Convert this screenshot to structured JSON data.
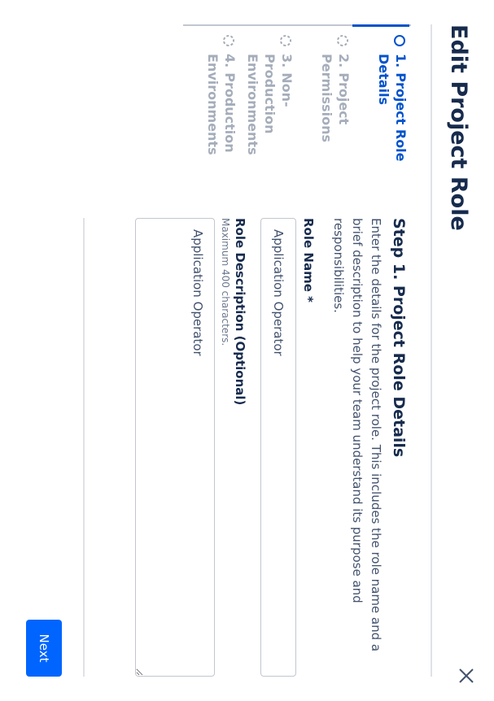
{
  "modal": {
    "title": "Edit Project Role",
    "close_icon": "close-icon"
  },
  "stepper": {
    "steps": [
      {
        "number": "1.",
        "label": "Project Role Details",
        "state": "active"
      },
      {
        "number": "2.",
        "label": "Project Permissions",
        "state": "inactive"
      },
      {
        "number": "3.",
        "label": "Non-Production Environments",
        "state": "inactive"
      },
      {
        "number": "4.",
        "label": "Production Environments",
        "state": "inactive"
      }
    ]
  },
  "form": {
    "step_title": "Step 1. Project Role Details",
    "step_description": "Enter the details for the project role. This includes the role name and a brief description to help your team understand its purpose and responsibilities.",
    "role_name_label": "Role Name *",
    "role_name_value": "Application Operator",
    "role_description_label": "Role Description (Optional)",
    "role_description_hint": "Maximum 400 characters.",
    "role_description_value": "Application Operator"
  },
  "footer": {
    "next_label": "Next"
  },
  "colors": {
    "primary": "#0065ff",
    "active_step": "#0052cc",
    "inactive_step": "#a5adba",
    "text": "#172b4d"
  }
}
